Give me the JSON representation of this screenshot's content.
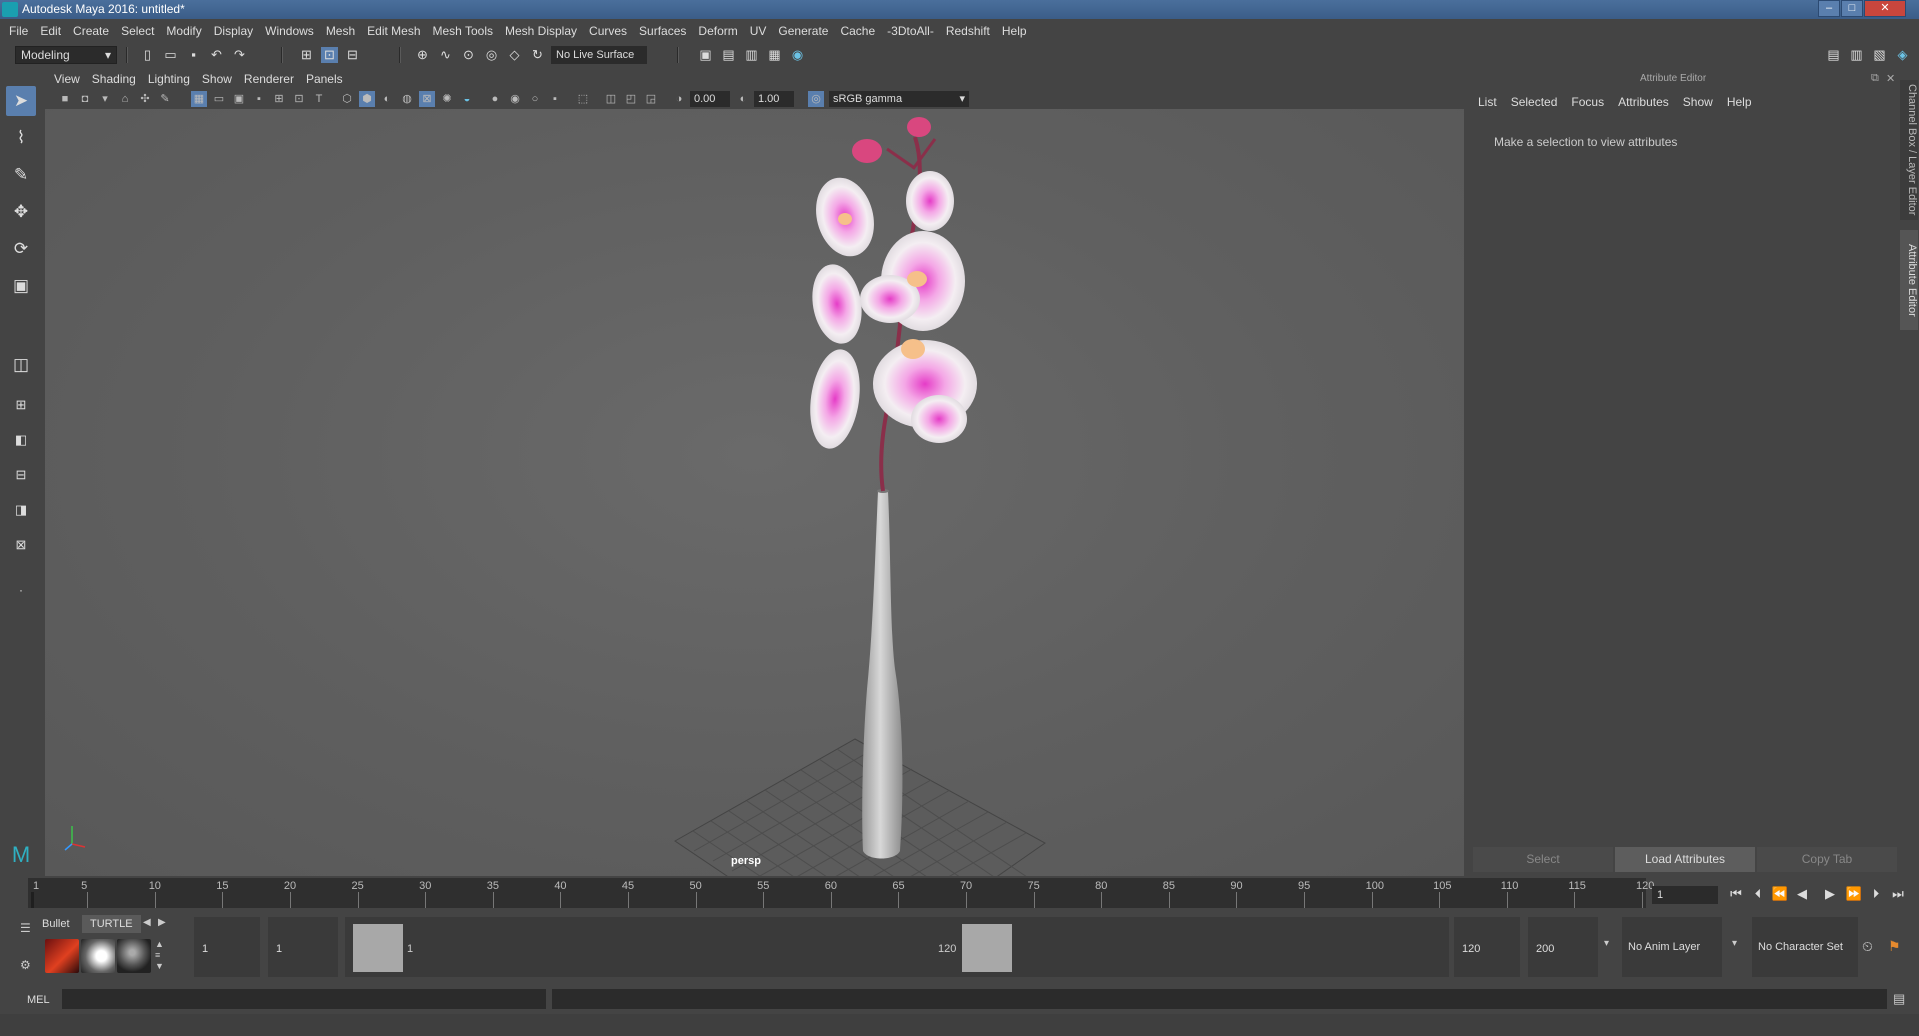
{
  "window": {
    "title": "Autodesk Maya 2016: untitled*"
  },
  "menubar": [
    "File",
    "Edit",
    "Create",
    "Select",
    "Modify",
    "Display",
    "Windows",
    "Mesh",
    "Edit Mesh",
    "Mesh Tools",
    "Mesh Display",
    "Curves",
    "Surfaces",
    "Deform",
    "UV",
    "Generate",
    "Cache",
    "-3DtoAll-",
    "Redshift",
    "Help"
  ],
  "statusline": {
    "mode": "Modeling",
    "live_surface": "No Live Surface"
  },
  "viewport": {
    "menu": [
      "View",
      "Shading",
      "Lighting",
      "Show",
      "Renderer",
      "Panels"
    ],
    "exposure": "0.00",
    "gamma": "1.00",
    "color_space": "sRGB gamma",
    "camera": "persp"
  },
  "attribute_editor": {
    "title": "Attribute Editor",
    "menu": [
      "List",
      "Selected",
      "Focus",
      "Attributes",
      "Show",
      "Help"
    ],
    "message": "Make a selection to view attributes",
    "buttons": [
      "Select",
      "Load Attributes",
      "Copy Tab"
    ],
    "side_tabs": [
      "Channel Box / Layer Editor",
      "Attribute Editor"
    ]
  },
  "timeline": {
    "ticks": [
      "1",
      "5",
      "10",
      "15",
      "20",
      "25",
      "30",
      "35",
      "40",
      "45",
      "50",
      "55",
      "60",
      "65",
      "70",
      "75",
      "80",
      "85",
      "90",
      "95",
      "100",
      "105",
      "110",
      "115",
      "120"
    ],
    "current_frame": "1"
  },
  "shelf": {
    "tabs": [
      "Bullet",
      "TURTLE"
    ]
  },
  "range": {
    "start": "1",
    "playback_start": "1",
    "range_start_label": "1",
    "range_end_label": "120",
    "playback_end": "120",
    "end": "200",
    "anim_layer": "No Anim Layer",
    "character_set": "No Character Set"
  },
  "commandline": {
    "label": "MEL"
  },
  "colors": {
    "accent": "#5a7fae",
    "panel": "#444444",
    "viewport": "#5f5f5f"
  }
}
